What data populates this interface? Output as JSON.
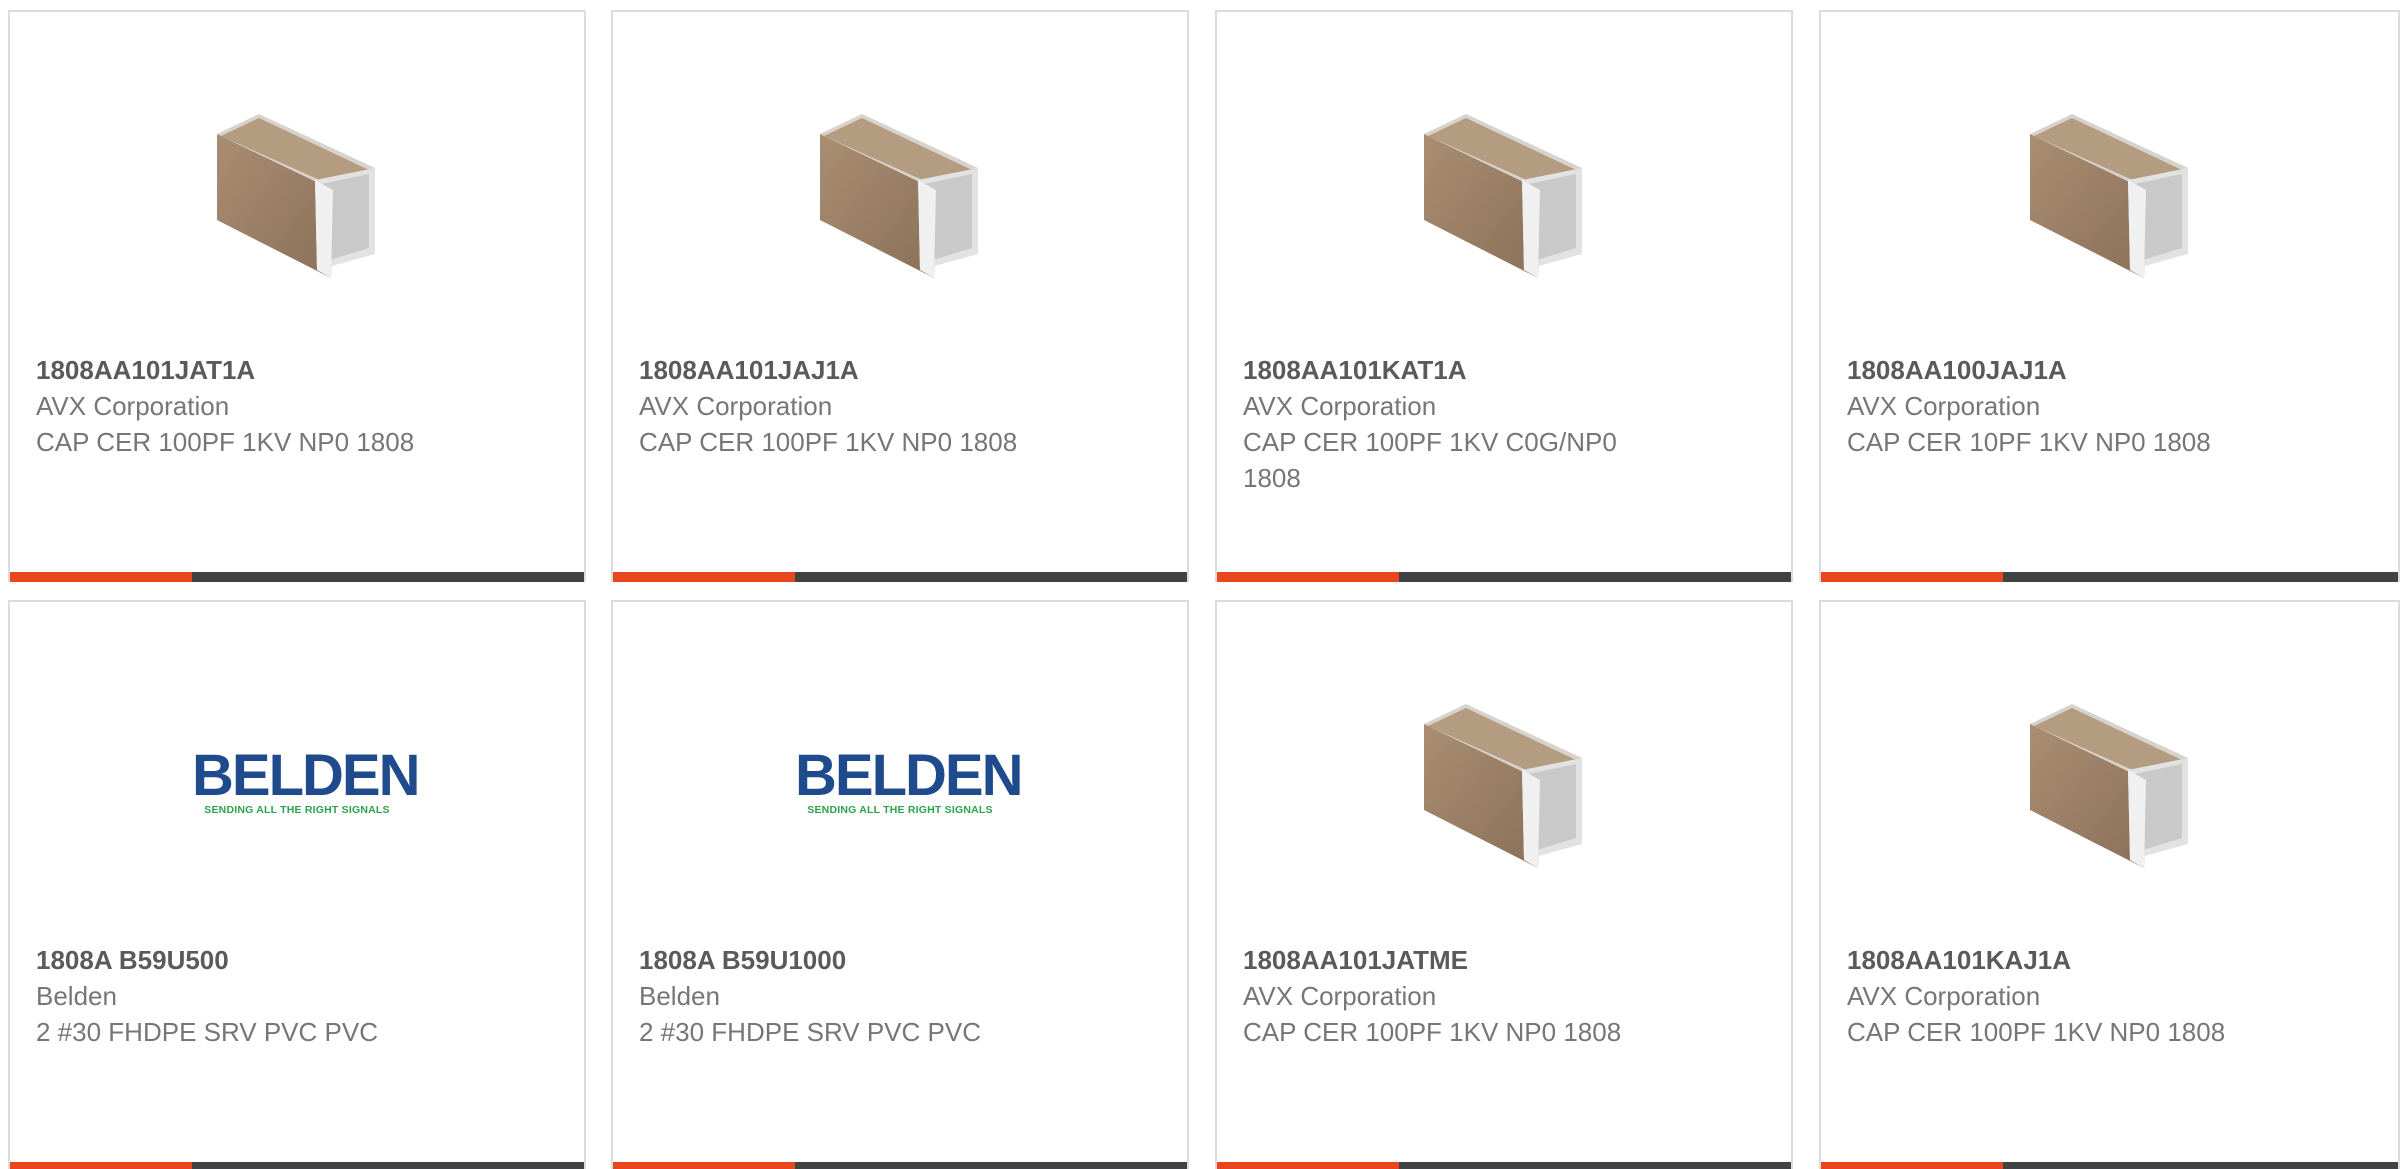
{
  "products": [
    {
      "part_number": "1808AA101JAT1A",
      "manufacturer": "AVX Corporation",
      "description": "CAP CER 100PF 1KV NP0 1808",
      "image": "capacitor-chip-image"
    },
    {
      "part_number": "1808AA101JAJ1A",
      "manufacturer": "AVX Corporation",
      "description": "CAP CER 100PF 1KV NP0 1808",
      "image": "capacitor-chip-image"
    },
    {
      "part_number": "1808AA101KAT1A",
      "manufacturer": "AVX Corporation",
      "description": "CAP CER 100PF 1KV C0G/NP0 1808",
      "image": "capacitor-chip-image"
    },
    {
      "part_number": "1808AA100JAJ1A",
      "manufacturer": "AVX Corporation",
      "description": "CAP CER 10PF 1KV NP0 1808",
      "image": "capacitor-chip-image"
    },
    {
      "part_number": "1808A B59U500",
      "manufacturer": "Belden",
      "description": "2 #30 FHDPE SRV PVC PVC",
      "image": "belden-logo",
      "logo_word": "BELDEN",
      "logo_tagline": "SENDING ALL THE RIGHT SIGNALS"
    },
    {
      "part_number": "1808A B59U1000",
      "manufacturer": "Belden",
      "description": "2 #30 FHDPE SRV PVC PVC",
      "image": "belden-logo",
      "logo_word": "BELDEN",
      "logo_tagline": "SENDING ALL THE RIGHT SIGNALS"
    },
    {
      "part_number": "1808AA101JATME",
      "manufacturer": "AVX Corporation",
      "description": "CAP CER 100PF 1KV NP0 1808",
      "image": "capacitor-chip-image"
    },
    {
      "part_number": "1808AA101KAJ1A",
      "manufacturer": "AVX Corporation",
      "description": "CAP CER 100PF 1KV NP0 1808",
      "image": "capacitor-chip-image"
    }
  ],
  "colors": {
    "accent": "#e8461e",
    "bar_dark": "#404244",
    "belden_blue": "#1f4a8c",
    "belden_green": "#2ea24b"
  }
}
